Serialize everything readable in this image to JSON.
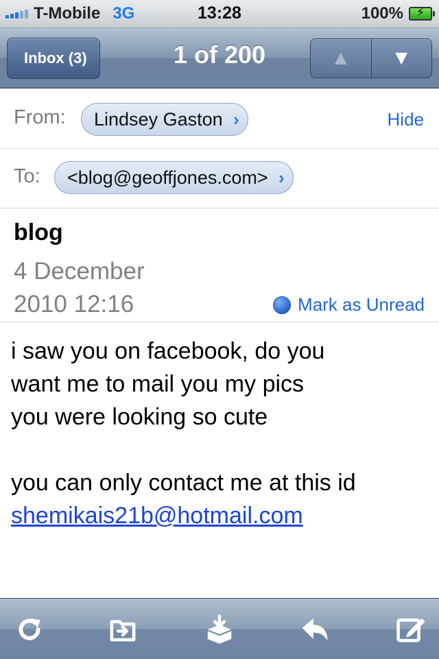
{
  "status_bar": {
    "carrier": "T-Mobile",
    "network": "3G",
    "time": "13:28",
    "battery": "100%",
    "battery_level": 1.0,
    "signal_bars": 3
  },
  "nav": {
    "back_label": "Inbox (3)",
    "title": "1 of 200",
    "up_icon": "up-arrow-icon",
    "down_icon": "down-arrow-icon"
  },
  "header": {
    "from_label": "From:",
    "from_name": "Lindsey Gaston",
    "hide_label": "Hide",
    "to_label": "To:",
    "to_address": "<blog@geoffjones.com>"
  },
  "message": {
    "subject": "blog",
    "date": "4 December 2010 12:16",
    "mark_unread_label": "Mark as Unread",
    "body_lines": [
      "i saw you on facebook,  do you",
      "want me to mail you my pics",
      "you were looking so cute"
    ],
    "contact_line": "you can only contact me at this id",
    "email_link": "shemikais21b@hotmail.com"
  },
  "toolbar": {
    "icons": [
      "refresh-icon",
      "move-folder-icon",
      "archive-icon",
      "reply-icon",
      "compose-icon"
    ]
  },
  "colors": {
    "link": "#2167d3",
    "nav_bar": "#6d84a3",
    "unread_dot": "#2a63cf"
  }
}
